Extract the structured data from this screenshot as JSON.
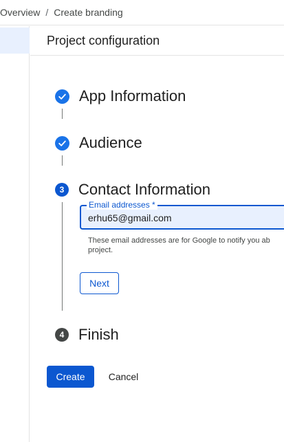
{
  "breadcrumb": {
    "items": [
      "Overview",
      "Create branding"
    ],
    "separator": "/"
  },
  "panel": {
    "title": "Project configuration"
  },
  "steps": [
    {
      "status": "completed",
      "icon": "check-icon",
      "title": "App Information"
    },
    {
      "status": "completed",
      "icon": "check-icon",
      "title": "Audience"
    },
    {
      "status": "active",
      "number": "3",
      "title": "Contact Information"
    },
    {
      "status": "pending",
      "number": "4",
      "title": "Finish"
    }
  ],
  "contact": {
    "email_label": "Email addresses *",
    "email_value": "erhu65@gmail.com",
    "helper_line1": "These email addresses are for Google to notify you ab",
    "helper_line2": "project.",
    "next_label": "Next"
  },
  "actions": {
    "create_label": "Create",
    "cancel_label": "Cancel"
  },
  "colors": {
    "primary": "#0b57d0",
    "check": "#1a73e8",
    "field_bg": "#e8f0fe",
    "inactive_step": "#444746"
  }
}
